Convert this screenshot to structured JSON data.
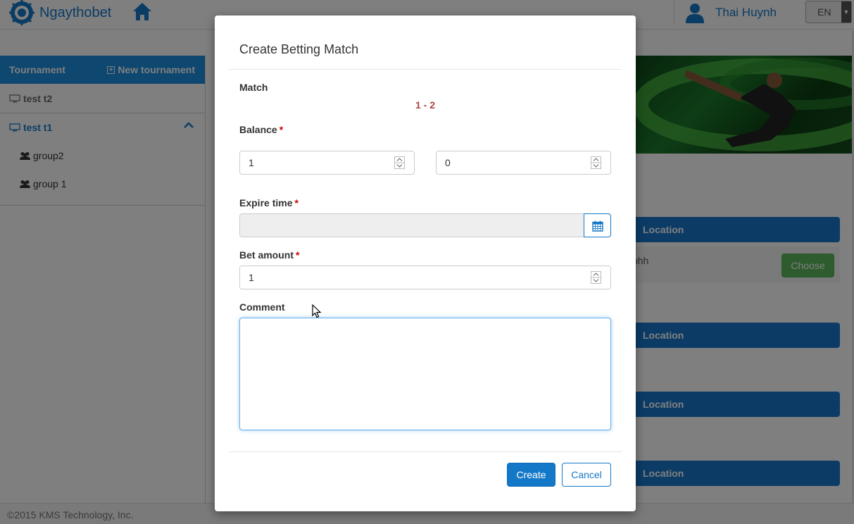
{
  "app": {
    "brand": "Ngaythobet",
    "user_name": "Thai Huynh",
    "language": "EN"
  },
  "sidebar": {
    "header_title": "Tournament",
    "new_tournament_label": "New tournament",
    "items": [
      {
        "label": "test t2"
      },
      {
        "label": "test t1",
        "expanded": true,
        "groups": [
          "group2",
          "group 1"
        ]
      }
    ]
  },
  "main": {
    "location_label": "Location",
    "location_item_name": "hhh",
    "choose_label": "Choose"
  },
  "footer": {
    "copyright": "©2015 KMS Technology, Inc."
  },
  "modal": {
    "title": "Create Betting Match",
    "match_label": "Match",
    "match_score": "1 - 2",
    "balance_label": "Balance",
    "balance_left": "1",
    "balance_right": "0",
    "expire_label": "Expire time",
    "expire_value": "",
    "bet_amount_label": "Bet amount",
    "bet_amount_value": "1",
    "comment_label": "Comment",
    "comment_value": "",
    "required_mark": "*",
    "create_label": "Create",
    "cancel_label": "Cancel"
  },
  "colors": {
    "primary": "#1478c8",
    "sidebar_header": "#1d8fe0",
    "success": "#5cb85c",
    "score": "#a94442",
    "required": "#cc0000"
  }
}
